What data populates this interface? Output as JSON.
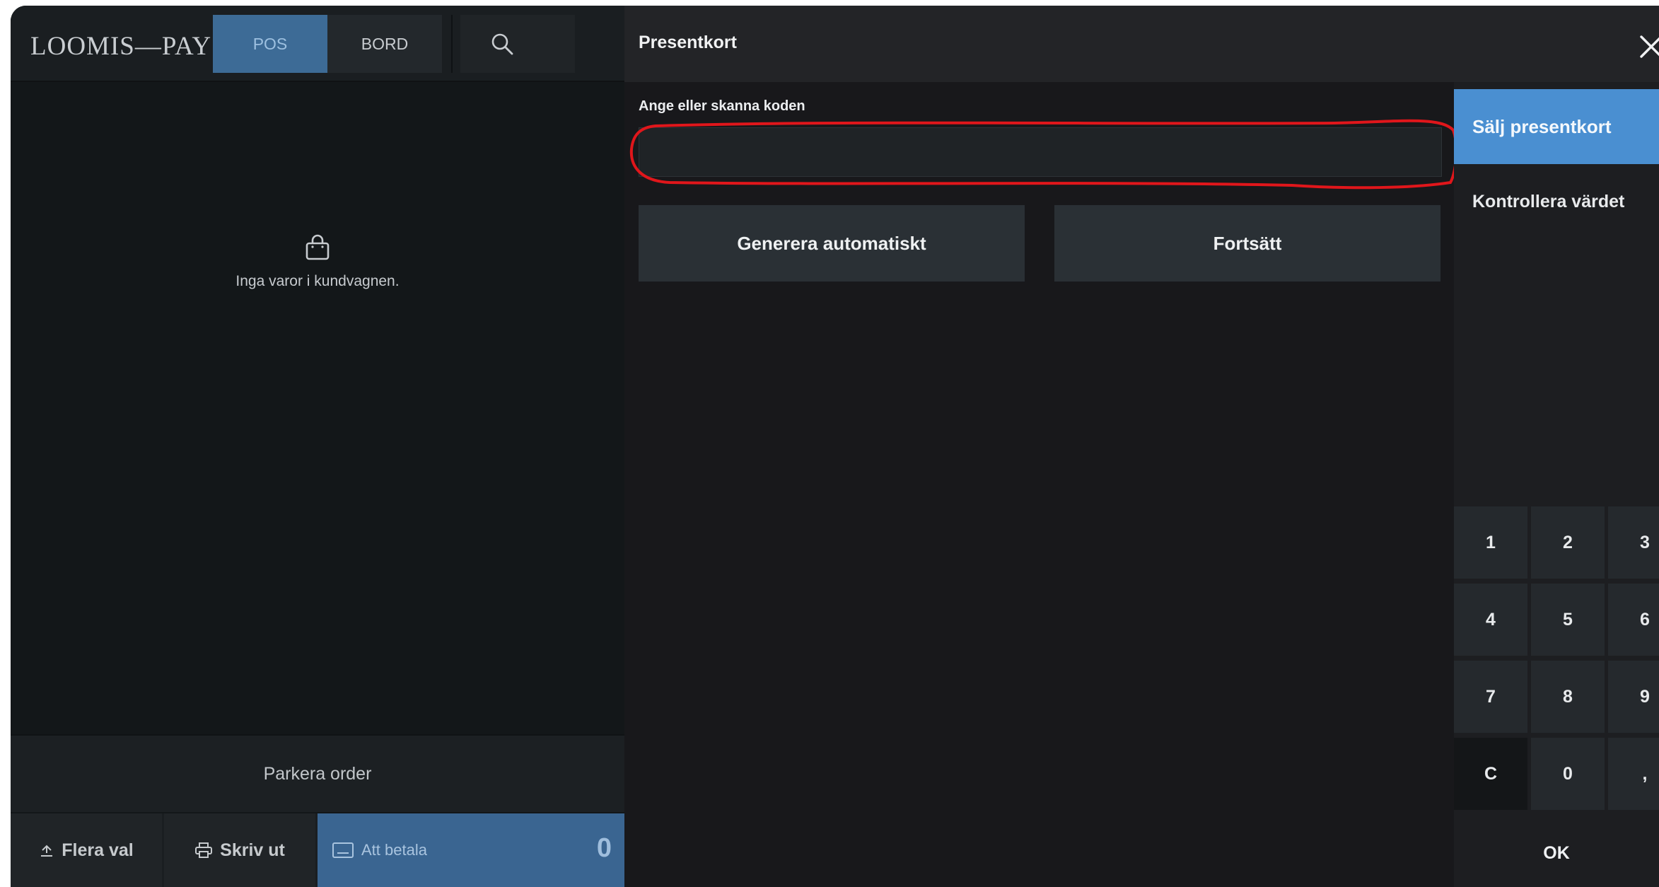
{
  "app": {
    "logo": "LOOMIS—PAY",
    "tabs": {
      "pos": "POS",
      "bord": "BORD"
    }
  },
  "cart": {
    "empty_text": "Inga varor i kundvagnen.",
    "park_label": "Parkera order"
  },
  "bottom": {
    "flera_val": "Flera val",
    "skriv_ut": "Skriv ut",
    "att_betala": "Att betala",
    "amount": "0"
  },
  "dialog": {
    "title": "Presentkort",
    "code_label": "Ange eller skanna koden",
    "code_value": "",
    "generate_label": "Generera automatiskt",
    "continue_label": "Fortsätt",
    "side_options": [
      "Sälj presentkort",
      "Kontrollera värdet"
    ],
    "selected_option": "Sälj presentkort",
    "keypad": [
      "1",
      "2",
      "3",
      "4",
      "5",
      "6",
      "7",
      "8",
      "9",
      "C",
      "0",
      ","
    ],
    "ok_label": "OK"
  },
  "colors": {
    "accent": "#4a8fd1",
    "tab_active": "#3d6b96",
    "highlight": "#e0161b"
  },
  "icons": [
    "search-icon",
    "shopping-bag-icon",
    "close-icon",
    "options-icon",
    "printer-icon",
    "payment-terminal-icon"
  ]
}
